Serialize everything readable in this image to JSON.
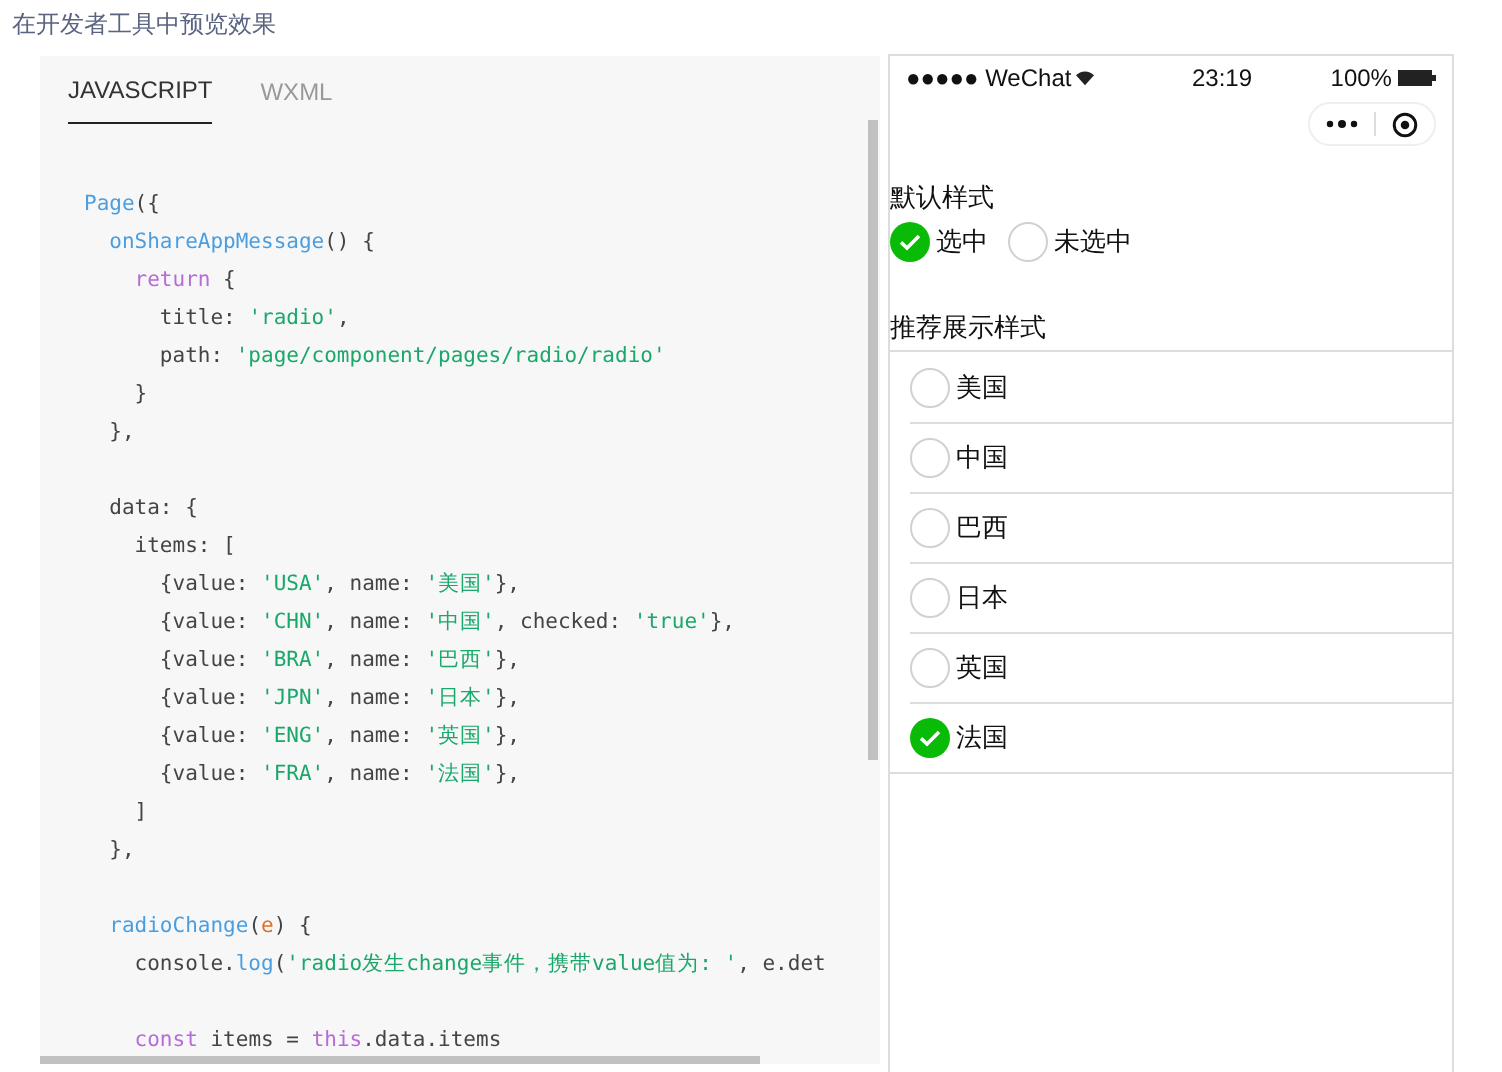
{
  "caption": "在开发者工具中预览效果",
  "tabs": [
    {
      "label": "JAVASCRIPT",
      "selected": true
    },
    {
      "label": "WXML",
      "selected": false
    }
  ],
  "code": [
    {
      "kind": "code",
      "tokens": [
        {
          "kind": "fn",
          "text": "Page"
        },
        {
          "kind": "plain",
          "text": "({"
        }
      ]
    },
    {
      "kind": "code",
      "tokens": [
        {
          "kind": "fn",
          "text": "  onShareAppMessage"
        },
        {
          "kind": "plain",
          "text": "() {"
        }
      ]
    },
    {
      "kind": "code",
      "tokens": [
        {
          "kind": "kw",
          "text": "    return"
        },
        {
          "kind": "plain",
          "text": " {"
        }
      ]
    },
    {
      "kind": "code",
      "tokens": [
        {
          "kind": "plain",
          "text": "      title: "
        },
        {
          "kind": "str",
          "text": "'radio'"
        },
        {
          "kind": "plain",
          "text": ","
        }
      ]
    },
    {
      "kind": "code",
      "tokens": [
        {
          "kind": "plain",
          "text": "      path: "
        },
        {
          "kind": "str",
          "text": "'page/component/pages/radio/radio'"
        }
      ]
    },
    {
      "kind": "code",
      "tokens": [
        {
          "kind": "plain",
          "text": "    }"
        }
      ]
    },
    {
      "kind": "code",
      "tokens": [
        {
          "kind": "plain",
          "text": "  },"
        }
      ]
    },
    {
      "kind": "blank"
    },
    {
      "kind": "code",
      "tokens": [
        {
          "kind": "plain",
          "text": "  data: {"
        }
      ]
    },
    {
      "kind": "code",
      "tokens": [
        {
          "kind": "plain",
          "text": "    items: ["
        }
      ]
    },
    {
      "kind": "code",
      "tokens": [
        {
          "kind": "plain",
          "text": "      {value: "
        },
        {
          "kind": "str",
          "text": "'USA'"
        },
        {
          "kind": "plain",
          "text": ", name: "
        },
        {
          "kind": "str",
          "text": "'美国'"
        },
        {
          "kind": "plain",
          "text": "},"
        }
      ]
    },
    {
      "kind": "code",
      "tokens": [
        {
          "kind": "plain",
          "text": "      {value: "
        },
        {
          "kind": "str",
          "text": "'CHN'"
        },
        {
          "kind": "plain",
          "text": ", name: "
        },
        {
          "kind": "str",
          "text": "'中国'"
        },
        {
          "kind": "plain",
          "text": ", checked: "
        },
        {
          "kind": "str",
          "text": "'true'"
        },
        {
          "kind": "plain",
          "text": "},"
        }
      ]
    },
    {
      "kind": "code",
      "tokens": [
        {
          "kind": "plain",
          "text": "      {value: "
        },
        {
          "kind": "str",
          "text": "'BRA'"
        },
        {
          "kind": "plain",
          "text": ", name: "
        },
        {
          "kind": "str",
          "text": "'巴西'"
        },
        {
          "kind": "plain",
          "text": "},"
        }
      ]
    },
    {
      "kind": "code",
      "tokens": [
        {
          "kind": "plain",
          "text": "      {value: "
        },
        {
          "kind": "str",
          "text": "'JPN'"
        },
        {
          "kind": "plain",
          "text": ", name: "
        },
        {
          "kind": "str",
          "text": "'日本'"
        },
        {
          "kind": "plain",
          "text": "},"
        }
      ]
    },
    {
      "kind": "code",
      "tokens": [
        {
          "kind": "plain",
          "text": "      {value: "
        },
        {
          "kind": "str",
          "text": "'ENG'"
        },
        {
          "kind": "plain",
          "text": ", name: "
        },
        {
          "kind": "str",
          "text": "'英国'"
        },
        {
          "kind": "plain",
          "text": "},"
        }
      ]
    },
    {
      "kind": "code",
      "tokens": [
        {
          "kind": "plain",
          "text": "      {value: "
        },
        {
          "kind": "str",
          "text": "'FRA'"
        },
        {
          "kind": "plain",
          "text": ", name: "
        },
        {
          "kind": "str",
          "text": "'法国'"
        },
        {
          "kind": "plain",
          "text": "},"
        }
      ]
    },
    {
      "kind": "code",
      "tokens": [
        {
          "kind": "plain",
          "text": "    ]"
        }
      ]
    },
    {
      "kind": "code",
      "tokens": [
        {
          "kind": "plain",
          "text": "  },"
        }
      ]
    },
    {
      "kind": "blank"
    },
    {
      "kind": "code",
      "tokens": [
        {
          "kind": "fn",
          "text": "  radioChange"
        },
        {
          "kind": "plain",
          "text": "("
        },
        {
          "kind": "param",
          "text": "e"
        },
        {
          "kind": "plain",
          "text": ") {"
        }
      ]
    },
    {
      "kind": "code",
      "tokens": [
        {
          "kind": "plain",
          "text": "    console."
        },
        {
          "kind": "fn",
          "text": "log"
        },
        {
          "kind": "plain",
          "text": "("
        },
        {
          "kind": "str",
          "text": "'radio发生change事件，携带value值为: '"
        },
        {
          "kind": "plain",
          "text": ", e.det"
        }
      ]
    },
    {
      "kind": "blank"
    },
    {
      "kind": "code",
      "tokens": [
        {
          "kind": "kw",
          "text": "    const"
        },
        {
          "kind": "plain",
          "text": " items = "
        },
        {
          "kind": "kw",
          "text": "this"
        },
        {
          "kind": "plain",
          "text": ".data.items"
        }
      ]
    }
  ],
  "phone": {
    "status": {
      "carrier": "●●●●● WeChat",
      "time": "23:19",
      "battery": "100%"
    },
    "section_1": {
      "title": "默认样式",
      "radios": [
        {
          "label": "选中",
          "selected": true
        },
        {
          "label": "未选中",
          "selected": false
        }
      ]
    },
    "section_2": {
      "title": "推荐展示样式",
      "items": [
        {
          "label": "美国",
          "selected": false
        },
        {
          "label": "中国",
          "selected": false
        },
        {
          "label": "巴西",
          "selected": false
        },
        {
          "label": "日本",
          "selected": false
        },
        {
          "label": "英国",
          "selected": false
        },
        {
          "label": "法国",
          "selected": true
        }
      ]
    }
  }
}
